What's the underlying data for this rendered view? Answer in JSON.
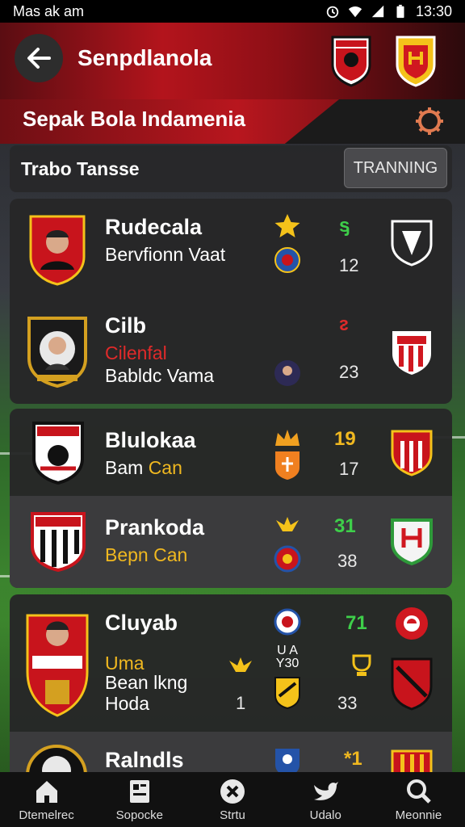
{
  "status_bar": {
    "left_text": "Mas ak am",
    "time": "13:30"
  },
  "header": {
    "title": "Senpdlanola",
    "subtitle": "Sepak Bola Indamenia"
  },
  "filter": {
    "label": "Trabo Tansse",
    "button_label": "TRANNING"
  },
  "colors": {
    "accent_red": "#b3141c",
    "yellow": "#f0b820",
    "green": "#3ecf4a",
    "red_stat": "#e02a2a"
  },
  "rows": [
    {
      "name": "Rudecala",
      "line1": "Bervfionn Vaat",
      "top_stat": "ᶊ",
      "bottom_num": "12",
      "stat_color": "#3ecf4a",
      "icon": "star-icon"
    },
    {
      "name": "Cilb",
      "line1": "Cilenfal",
      "line2": "Babldc Vama",
      "top_stat": "ᴤ",
      "bottom_num": "23",
      "stat_color": "#e02a2a"
    },
    {
      "name": "Blulokaa",
      "line1_prefix": "Bam",
      "line1_hl": "Can",
      "top_stat": "19",
      "bottom_num": "17",
      "stat_color": "#f0b820"
    },
    {
      "name": "Prankoda",
      "line1_prefix": "Bepn",
      "line1_hl": "Can",
      "top_stat": "31",
      "bottom_num": "38",
      "stat_color": "#3ecf4a"
    },
    {
      "name": "Cluyab",
      "line1": "Uma",
      "line2": "Bean lkng",
      "line3": "Hoda",
      "mid_num": "1",
      "center_text": "U A\nY30",
      "top_stat": "71",
      "bottom_num": "33",
      "stat_color": "#3ecf4a"
    },
    {
      "name": "Ralndls",
      "top_stat": "*1",
      "stat_color": "#f0b820"
    }
  ],
  "nav": [
    {
      "label": "Dtemelrec",
      "icon": "home-icon"
    },
    {
      "label": "Sopocke",
      "icon": "document-icon"
    },
    {
      "label": "Strtu",
      "icon": "ball-icon"
    },
    {
      "label": "Udalo",
      "icon": "bird-icon"
    },
    {
      "label": "Meonnie",
      "icon": "search-icon"
    }
  ]
}
